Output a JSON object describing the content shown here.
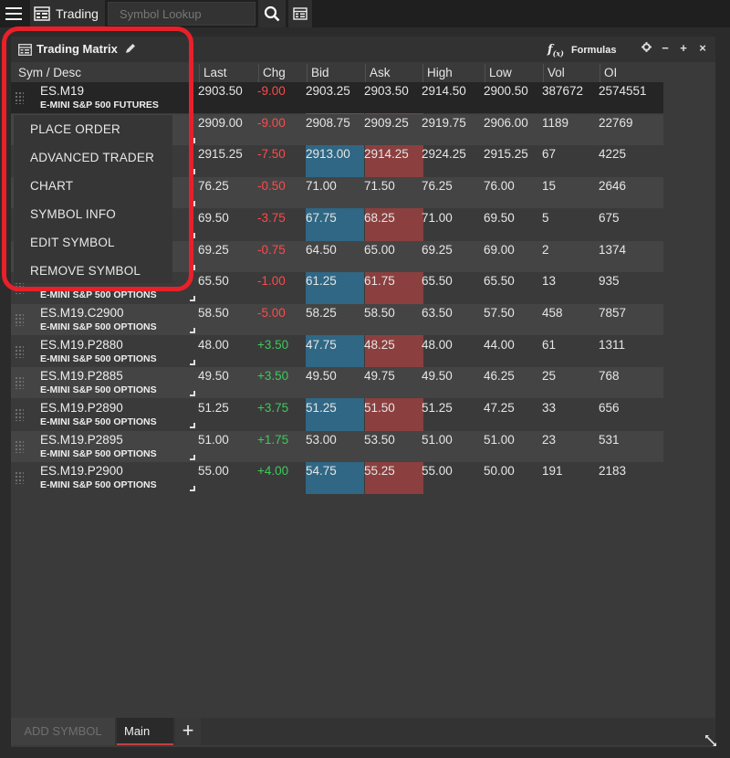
{
  "topbar": {
    "tab_label": "Trading",
    "search_placeholder": "Symbol Lookup"
  },
  "panel": {
    "title": "Trading Matrix",
    "formulas_label": "Formulas",
    "controls": [
      "gear",
      "minimize",
      "add",
      "close"
    ]
  },
  "columns": [
    "Sym / Desc",
    "Last",
    "Chg",
    "Bid",
    "Ask",
    "High",
    "Low",
    "Vol",
    "OI"
  ],
  "rows": [
    {
      "sym": "ES.M19",
      "desc": "E-MINI S&P 500 FUTURES",
      "last": "2903.50",
      "chg": "-9.00",
      "bid": "2903.25",
      "ask": "2903.50",
      "high": "2914.50",
      "low": "2900.50",
      "vol": "387672",
      "oi": "2574551"
    },
    {
      "sym": "",
      "desc": "",
      "last": "2909.00",
      "chg": "-9.00",
      "bid": "2908.75",
      "ask": "2909.25",
      "high": "2919.75",
      "low": "2906.00",
      "vol": "1189",
      "oi": "22769"
    },
    {
      "sym": "",
      "desc": "",
      "last": "2915.25",
      "chg": "-7.50",
      "bid": "2913.00",
      "ask": "2914.25",
      "high": "2924.25",
      "low": "2915.25",
      "vol": "67",
      "oi": "4225"
    },
    {
      "sym": "",
      "desc": "",
      "last": "76.25",
      "chg": "-0.50",
      "bid": "71.00",
      "ask": "71.50",
      "high": "76.25",
      "low": "76.00",
      "vol": "15",
      "oi": "2646"
    },
    {
      "sym": "",
      "desc": "",
      "last": "69.50",
      "chg": "-3.75",
      "bid": "67.75",
      "ask": "68.25",
      "high": "71.00",
      "low": "69.50",
      "vol": "5",
      "oi": "675"
    },
    {
      "sym": "",
      "desc": "",
      "last": "69.25",
      "chg": "-0.75",
      "bid": "64.50",
      "ask": "65.00",
      "high": "69.25",
      "low": "69.00",
      "vol": "2",
      "oi": "1374"
    },
    {
      "sym": "",
      "desc": "E-MINI S&P 500 OPTIONS",
      "last": "65.50",
      "chg": "-1.00",
      "bid": "61.25",
      "ask": "61.75",
      "high": "65.50",
      "low": "65.50",
      "vol": "13",
      "oi": "935"
    },
    {
      "sym": "ES.M19.C2900",
      "desc": "E-MINI S&P 500 OPTIONS",
      "last": "58.50",
      "chg": "-5.00",
      "bid": "58.25",
      "ask": "58.50",
      "high": "63.50",
      "low": "57.50",
      "vol": "458",
      "oi": "7857"
    },
    {
      "sym": "ES.M19.P2880",
      "desc": "E-MINI S&P 500 OPTIONS",
      "last": "48.00",
      "chg": "+3.50",
      "bid": "47.75",
      "ask": "48.25",
      "high": "48.00",
      "low": "44.00",
      "vol": "61",
      "oi": "1311"
    },
    {
      "sym": "ES.M19.P2885",
      "desc": "E-MINI S&P 500 OPTIONS",
      "last": "49.50",
      "chg": "+3.50",
      "bid": "49.50",
      "ask": "49.75",
      "high": "49.50",
      "low": "46.25",
      "vol": "25",
      "oi": "768"
    },
    {
      "sym": "ES.M19.P2890",
      "desc": "E-MINI S&P 500 OPTIONS",
      "last": "51.25",
      "chg": "+3.75",
      "bid": "51.25",
      "ask": "51.50",
      "high": "51.25",
      "low": "47.25",
      "vol": "33",
      "oi": "656"
    },
    {
      "sym": "ES.M19.P2895",
      "desc": "E-MINI S&P 500 OPTIONS",
      "last": "51.00",
      "chg": "+1.75",
      "bid": "53.00",
      "ask": "53.50",
      "high": "51.00",
      "low": "51.00",
      "vol": "23",
      "oi": "531"
    },
    {
      "sym": "ES.M19.P2900",
      "desc": "E-MINI S&P 500 OPTIONS",
      "last": "55.00",
      "chg": "+4.00",
      "bid": "54.75",
      "ask": "55.25",
      "high": "55.00",
      "low": "50.00",
      "vol": "191",
      "oi": "2183"
    }
  ],
  "context_menu": [
    "PLACE ORDER",
    "ADVANCED TRADER",
    "CHART",
    "SYMBOL INFO",
    "EDIT SYMBOL",
    "REMOVE SYMBOL"
  ],
  "bottom_tabs": {
    "add_symbol": "ADD SYMBOL",
    "main_tab": "Main",
    "add_tab": "+"
  },
  "colors": {
    "bid_column": "#2f6784",
    "ask_column": "#8b3f3f",
    "negative": "#ff4a4a",
    "positive": "#3ec95a",
    "highlight": "#e8202a"
  }
}
